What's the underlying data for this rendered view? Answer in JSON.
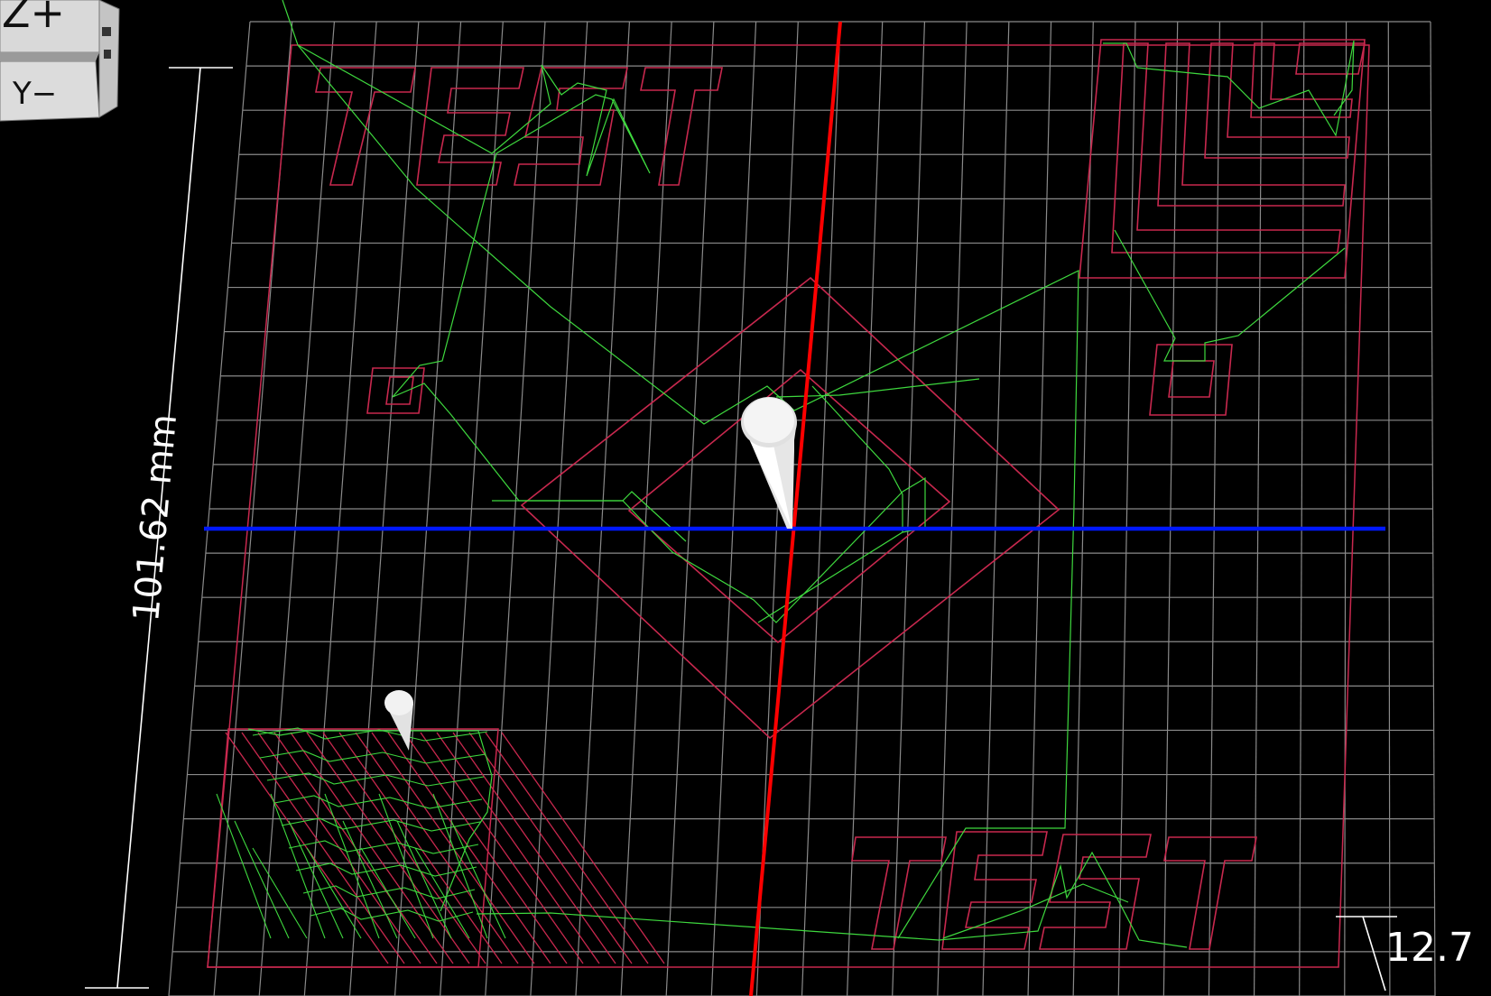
{
  "viewport": {
    "background": "#000000",
    "grid_color": "#8a8a8a",
    "toolpath_outline_color": "#c8284e",
    "travel_color": "#3ed83e",
    "x_axis_color": "#ff0000",
    "y_axis_color": "#0018ff",
    "tool_color": "#e8e8e8"
  },
  "view_cube": {
    "top_face_label": "Z+",
    "front_face_label": "Y−",
    "side_face_label": ""
  },
  "dimensions": {
    "height_label": "101.62 mm",
    "corner_label": "12.7"
  },
  "engraved_text": {
    "top_left": "TEST",
    "bottom_right": "TEST"
  },
  "icons": {
    "tool_main": "cone-tool-icon",
    "tool_secondary": "cone-tool-icon"
  }
}
